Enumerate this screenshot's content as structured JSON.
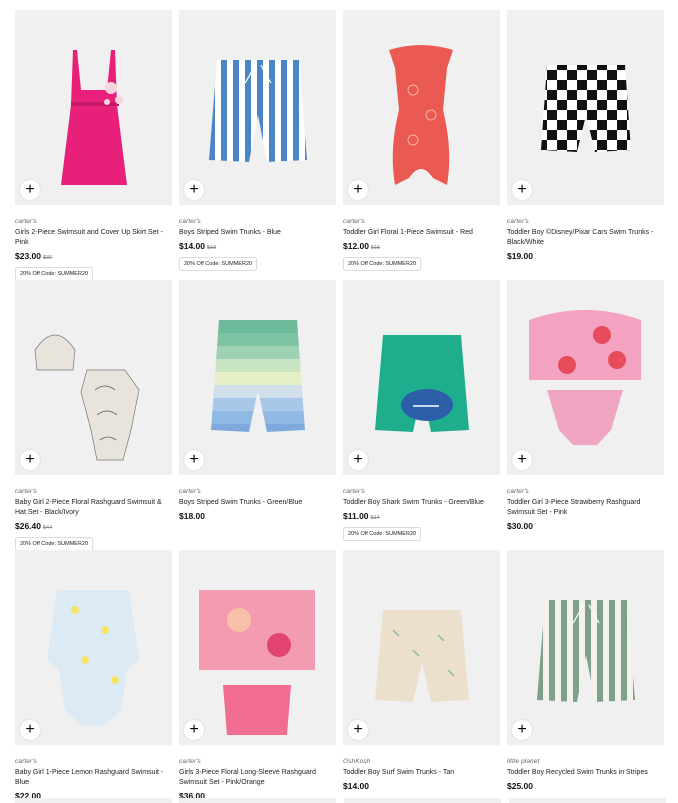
{
  "products": [
    {
      "brand": "carter's",
      "title": "Girls 2-Piece Swimsuit and Cover Up Skirt Set - Pink",
      "price": "$23.00",
      "original_price": "$30",
      "promo": "20% Off Code: SUMMER20",
      "art": "pink-suit"
    },
    {
      "brand": "carter's",
      "title": "Boys Striped Swim Trunks - Blue",
      "price": "$14.00",
      "original_price": "$18",
      "promo": "20% Off Code: SUMMER20",
      "art": "blue-trunks"
    },
    {
      "brand": "carter's",
      "title": "Toddler Girl Floral 1-Piece Swimsuit - Red",
      "price": "$12.00",
      "original_price": "$15",
      "promo": "20% Off Code: SUMMER20",
      "art": "red-suit"
    },
    {
      "brand": "carter's",
      "title": "Toddler Boy ©Disney/Pixar Cars Swim Trunks - Black/White",
      "price": "$19.00",
      "original_price": "",
      "promo": "",
      "art": "check-trunks"
    },
    {
      "brand": "carter's",
      "title": "Baby Girl 2-Piece Floral Rashguard Swimsuit & Hat Set - Black/Ivory",
      "price": "$26.40",
      "original_price": "$44",
      "promo": "20% Off Code: SUMMER20",
      "art": "floral-set"
    },
    {
      "brand": "carter's",
      "title": "Boys Striped Swim Trunks - Green/Blue",
      "price": "$18.00",
      "original_price": "",
      "promo": "",
      "art": "green-trunks"
    },
    {
      "brand": "carter's",
      "title": "Toddler Boy Shark Swim Trunks - Green/Blue",
      "price": "$11.00",
      "original_price": "$14",
      "promo": "20% Off Code: SUMMER20",
      "art": "shark-trunks"
    },
    {
      "brand": "carter's",
      "title": "Toddler Girl 3-Piece Strawberry Rashguard Swimsuit Set - Pink",
      "price": "$30.00",
      "original_price": "",
      "promo": "",
      "art": "strawberry-set"
    },
    {
      "brand": "carter's",
      "title": "Baby Girl 1-Piece Lemon Rashguard Swimsuit - Blue",
      "price": "$22.00",
      "original_price": "",
      "promo": "",
      "art": "lemon-suit"
    },
    {
      "brand": "carter's",
      "title": "Girls 3-Piece Floral Long-Sleeve Rashguard Swimsuit Set - Pink/Orange",
      "price": "$36.00",
      "original_price": "",
      "promo": "",
      "art": "pink-orange-set"
    },
    {
      "brand": "OshKosh",
      "title": "Toddler Boy Surf Swim Trunks - Tan",
      "price": "$14.00",
      "original_price": "",
      "promo": "",
      "art": "tan-trunks"
    },
    {
      "brand": "little planet",
      "title": "Toddler Boy Recycled Swim Trunks in Stripes",
      "price": "$25.00",
      "original_price": "",
      "promo": "",
      "art": "sage-trunks"
    }
  ],
  "add_symbol": "+"
}
